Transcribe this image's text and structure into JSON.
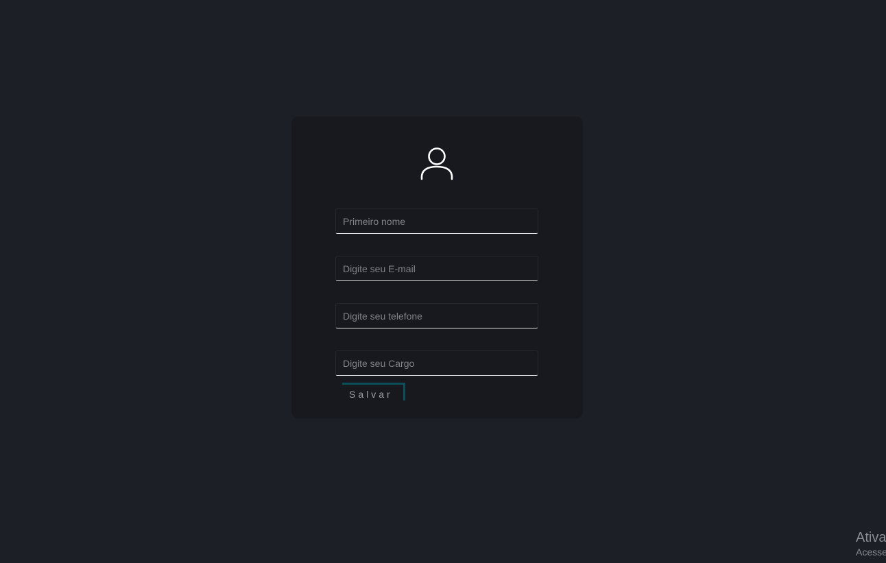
{
  "form": {
    "avatar_icon": "user-icon",
    "fields": [
      {
        "name": "first-name",
        "placeholder": "Primeiro nome",
        "value": ""
      },
      {
        "name": "email",
        "placeholder": "Digite seu E-mail",
        "value": ""
      },
      {
        "name": "phone",
        "placeholder": "Digite seu telefone",
        "value": ""
      },
      {
        "name": "role",
        "placeholder": "Digite seu Cargo",
        "value": ""
      }
    ],
    "save_label": "Salvar"
  },
  "watermark": {
    "title": "Ativa",
    "subtitle": "Acesse"
  },
  "colors": {
    "background": "#1c1f26",
    "card": "#18191f",
    "accent": "#0c4f58"
  }
}
